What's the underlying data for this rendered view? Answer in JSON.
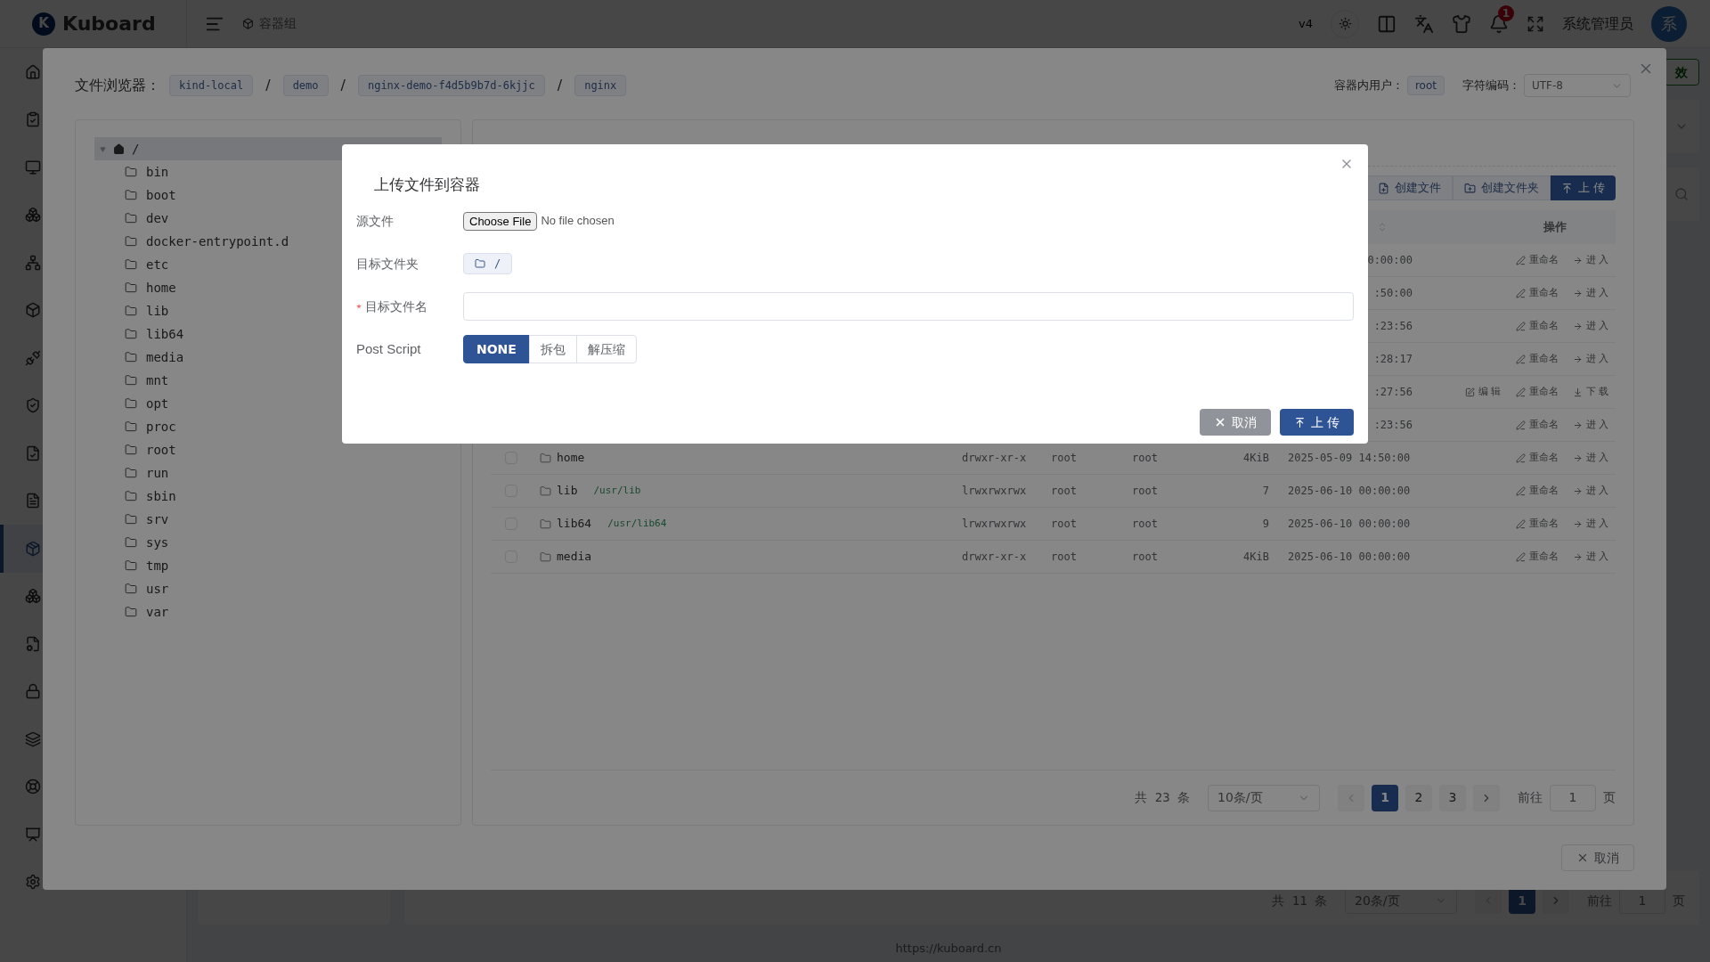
{
  "header": {
    "logo": "K",
    "brand": "Kuboard",
    "breadcrumb": "容器组",
    "version": "v4",
    "notification_count": "1",
    "user": "系统管理员",
    "avatar": "系"
  },
  "sidebar": {
    "items": [
      {
        "selected": false
      },
      {
        "selected": false
      },
      {
        "selected": false
      },
      {
        "selected": false
      },
      {
        "selected": false
      },
      {
        "selected": false
      },
      {
        "selected": false
      },
      {
        "selected": false
      },
      {
        "selected": false
      },
      {
        "selected": false
      },
      {
        "selected": true
      },
      {
        "selected": false
      },
      {
        "selected": false
      },
      {
        "selected": false
      },
      {
        "selected": false
      },
      {
        "selected": false
      },
      {
        "selected": false
      },
      {
        "selected": false
      }
    ]
  },
  "background": {
    "apply_button": "效",
    "pagination": {
      "total": "共 11 条",
      "page_size": "20条/页",
      "pages": [
        {
          "label": "1",
          "selected": true
        }
      ],
      "goto_label": "前往",
      "goto_value": "1",
      "goto_suffix": "页"
    },
    "footer_link": "https://kuboard.cn"
  },
  "file_browser": {
    "title": "文件浏览器：",
    "path": [
      {
        "label": "kind-local",
        "separator": "/"
      },
      {
        "label": "demo",
        "separator": "/"
      },
      {
        "label": "nginx-demo-f4d5b9b7d-6kjjc",
        "separator": "/"
      },
      {
        "label": "nginx"
      }
    ],
    "user_label": "容器内用户：",
    "user": "root",
    "encoding_label": "字符编码：",
    "encoding": "UTF-8",
    "tree": {
      "label": "/",
      "expanded": true,
      "selected": true,
      "children": [
        {
          "label": "bin"
        },
        {
          "label": "boot"
        },
        {
          "label": "dev"
        },
        {
          "label": "docker-entrypoint.d"
        },
        {
          "label": "etc"
        },
        {
          "label": "home"
        },
        {
          "label": "lib"
        },
        {
          "label": "lib64"
        },
        {
          "label": "media"
        },
        {
          "label": "mnt"
        },
        {
          "label": "opt"
        },
        {
          "label": "proc"
        },
        {
          "label": "root"
        },
        {
          "label": "run"
        },
        {
          "label": "sbin"
        },
        {
          "label": "srv"
        },
        {
          "label": "sys"
        },
        {
          "label": "tmp"
        },
        {
          "label": "usr"
        },
        {
          "label": "var"
        }
      ]
    },
    "toolbar": [
      {
        "kind": "file",
        "label": "创建文件",
        "primary": false
      },
      {
        "kind": "folder",
        "label": "创建文件夹",
        "primary": false
      },
      {
        "kind": "upload",
        "label": "上 传",
        "primary": true
      }
    ],
    "table": {
      "action_header": "操作",
      "rows": [
        {
          "kind": "covered",
          "time": "0:00:00",
          "actions": [
            {
              "kind": "rename",
              "label": "重命名"
            },
            {
              "kind": "enter",
              "label": "进 入"
            }
          ]
        },
        {
          "kind": "covered",
          "time": ":50:00",
          "actions": [
            {
              "kind": "rename",
              "label": "重命名"
            },
            {
              "kind": "enter",
              "label": "进 入"
            }
          ]
        },
        {
          "kind": "covered",
          "time": ":23:56",
          "actions": [
            {
              "kind": "rename",
              "label": "重命名"
            },
            {
              "kind": "enter",
              "label": "进 入"
            }
          ]
        },
        {
          "kind": "covered",
          "time": ":28:17",
          "actions": [
            {
              "kind": "rename",
              "label": "重命名"
            },
            {
              "kind": "enter",
              "label": "进 入"
            }
          ]
        },
        {
          "kind": "covered",
          "time": ":27:56",
          "actions": [
            {
              "kind": "edit",
              "label": "编 辑"
            },
            {
              "kind": "rename",
              "label": "重命名"
            },
            {
              "kind": "download",
              "label": "下 载"
            }
          ]
        },
        {
          "kind": "covered",
          "time": ":23:56",
          "actions": [
            {
              "kind": "rename",
              "label": "重命名"
            },
            {
              "kind": "enter",
              "label": "进 入"
            }
          ]
        },
        {
          "kind": "folder",
          "checked": false,
          "name": "home",
          "perm": "drwxr-xr-x",
          "owner": "root",
          "group": "root",
          "size": "4KiB",
          "time": "2025-05-09 14:50:00",
          "actions": [
            {
              "kind": "rename",
              "label": "重命名"
            },
            {
              "kind": "enter",
              "label": "进 入"
            }
          ]
        },
        {
          "kind": "folder",
          "checked": false,
          "name": "lib",
          "link": "/usr/lib",
          "perm": "lrwxrwxrwx",
          "owner": "root",
          "group": "root",
          "size": "7",
          "time": "2025-06-10 00:00:00",
          "actions": [
            {
              "kind": "rename",
              "label": "重命名"
            },
            {
              "kind": "enter",
              "label": "进 入"
            }
          ]
        },
        {
          "kind": "folder",
          "checked": false,
          "name": "lib64",
          "link": "/usr/lib64",
          "perm": "lrwxrwxrwx",
          "owner": "root",
          "group": "root",
          "size": "9",
          "time": "2025-06-10 00:00:00",
          "actions": [
            {
              "kind": "rename",
              "label": "重命名"
            },
            {
              "kind": "enter",
              "label": "进 入"
            }
          ]
        },
        {
          "kind": "folder",
          "checked": false,
          "name": "media",
          "perm": "drwxr-xr-x",
          "owner": "root",
          "group": "root",
          "size": "4KiB",
          "time": "2025-06-10 00:00:00",
          "actions": [
            {
              "kind": "rename",
              "label": "重命名"
            },
            {
              "kind": "enter",
              "label": "进 入"
            }
          ]
        }
      ]
    },
    "pagination": {
      "total": "共 23 条",
      "page_size": "10条/页",
      "pages": [
        {
          "label": "1",
          "selected": true
        },
        {
          "label": "2",
          "selected": false
        },
        {
          "label": "3",
          "selected": false
        }
      ],
      "goto_label": "前往",
      "goto_value": "1",
      "goto_suffix": "页"
    },
    "cancel": "取消"
  },
  "upload_dialog": {
    "title": "上传文件到容器",
    "source_label": "源文件",
    "choose_button": "Choose File",
    "file_status": "No file chosen",
    "folder_label": "目标文件夹",
    "folder": "/",
    "name_label": "目标文件名",
    "name_required": true,
    "script_label": "Post Script",
    "scripts": [
      {
        "label": "NONE",
        "selected": true
      },
      {
        "label": "拆包",
        "selected": false
      },
      {
        "label": "解压缩",
        "selected": false
      }
    ],
    "cancel": "取消",
    "upload": "上 传"
  }
}
